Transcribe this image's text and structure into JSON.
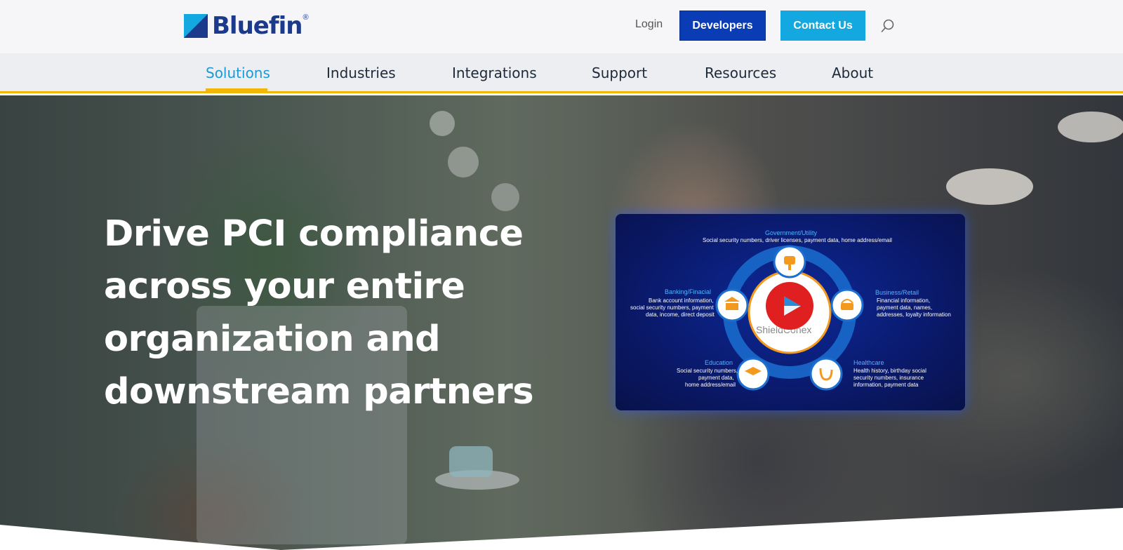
{
  "brand": {
    "name": "Bluefin",
    "reg": "®"
  },
  "header": {
    "login": "Login",
    "developers": "Developers",
    "contact": "Contact Us",
    "search_icon": "search-icon"
  },
  "nav": {
    "items": [
      {
        "label": "Solutions"
      },
      {
        "label": "Industries"
      },
      {
        "label": "Integrations"
      },
      {
        "label": "Support"
      },
      {
        "label": "Resources"
      },
      {
        "label": "About"
      }
    ],
    "active": "Solutions"
  },
  "hero": {
    "title": "Drive PCI compliance across your entire organization and downstream partners"
  },
  "video": {
    "center_label": "ShieldConex",
    "gov": {
      "title": "Government/Utility",
      "text": "Social security numbers, driver licenses, payment data, home address/email"
    },
    "banking": {
      "title": "Banking/Finacial",
      "line1": "Bank account information,",
      "line2": "social security numbers, payment",
      "line3": "data, income, direct deposit"
    },
    "business": {
      "title": "Business/Retail",
      "line1": "Financial information,",
      "line2": "payment data, names,",
      "line3": "addresses, loyalty information"
    },
    "education": {
      "title": "Education",
      "line1": "Social security numbers,",
      "line2": "payment data,",
      "line3": "home address/email"
    },
    "healthcare": {
      "title": "Healthcare",
      "line1": "Health history, birthday social",
      "line2": "security numbers, insurance",
      "line3": "information, payment data"
    }
  },
  "colors": {
    "brand_blue": "#1b3a8c",
    "developers_bg": "#0a3db5",
    "contact_bg": "#14a8e0",
    "nav_active": "#1a9ad6",
    "accent_yellow": "#f2b705",
    "play_red": "#e02020"
  }
}
